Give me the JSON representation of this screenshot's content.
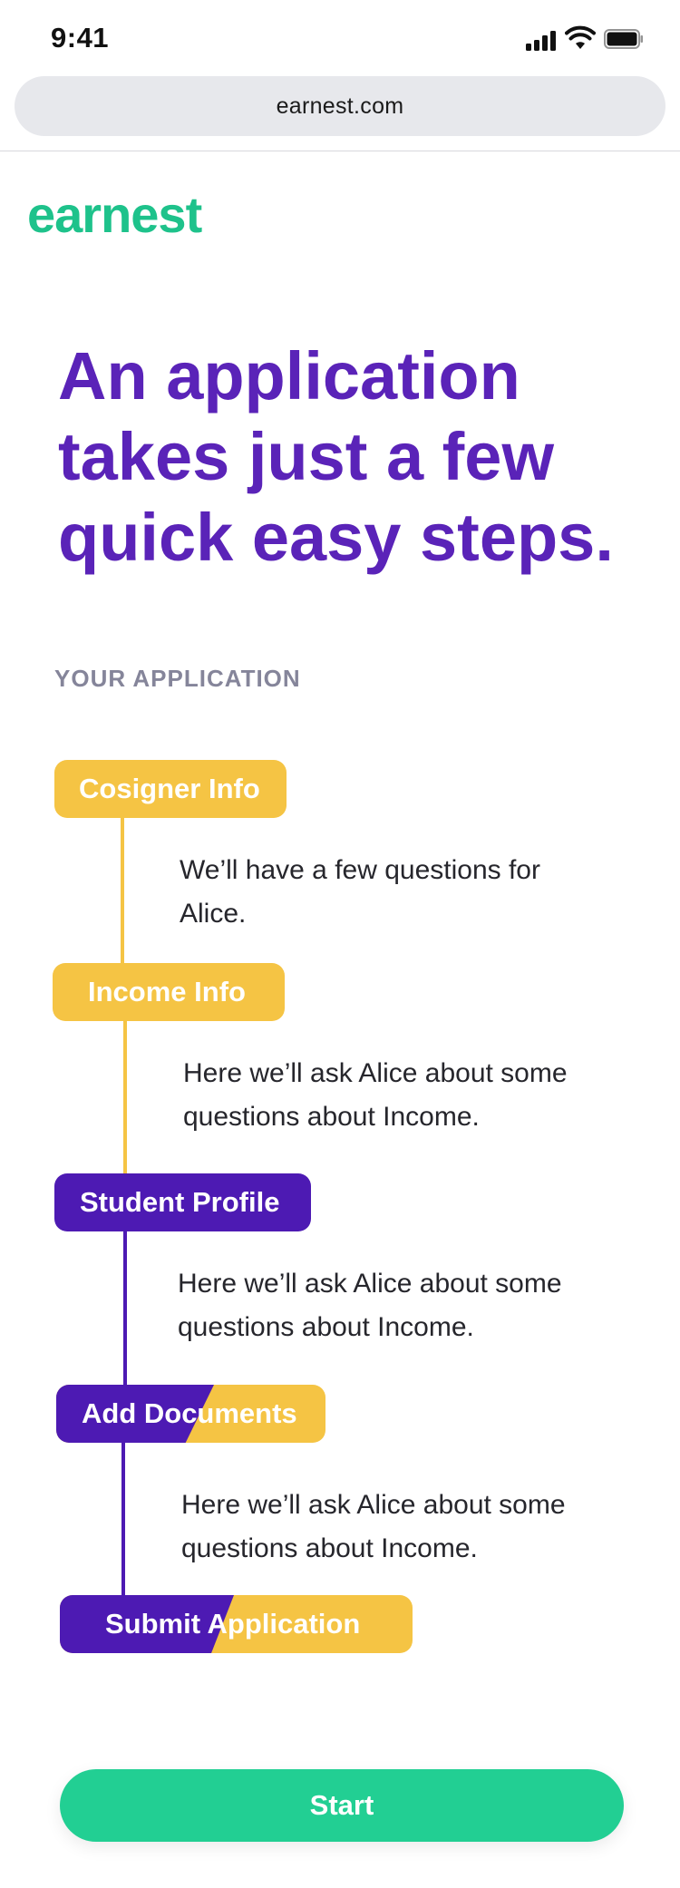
{
  "status_bar": {
    "time": "9:41"
  },
  "browser": {
    "url": "earnest.com"
  },
  "brand": {
    "logo_text": "earnest",
    "color": "#1ec28b"
  },
  "headline": "An application takes just a few quick easy steps.",
  "section_label": "YOUR APPLICATION",
  "steps": [
    {
      "label": "Cosigner Info",
      "status_color": "#f5c444",
      "description": "We’ll have a few questions for Alice."
    },
    {
      "label": "Income Info",
      "status_color": "#f5c444",
      "description": "Here we’ll ask Alice about some questions about Income."
    },
    {
      "label": "Student Profile",
      "status_color": "#4d1ab3",
      "description": "Here we’ll ask Alice about some questions about Income."
    },
    {
      "label": "Add Documents",
      "status_color": "split",
      "description": "Here we’ll ask Alice about some questions about Income."
    },
    {
      "label": "Submit Application",
      "status_color": "split"
    }
  ],
  "colors": {
    "purple": "#4d1ab3",
    "yellow": "#f5c444",
    "headline": "#5a23b8",
    "cta": "#22cf93"
  },
  "cta": {
    "label": "Start"
  }
}
